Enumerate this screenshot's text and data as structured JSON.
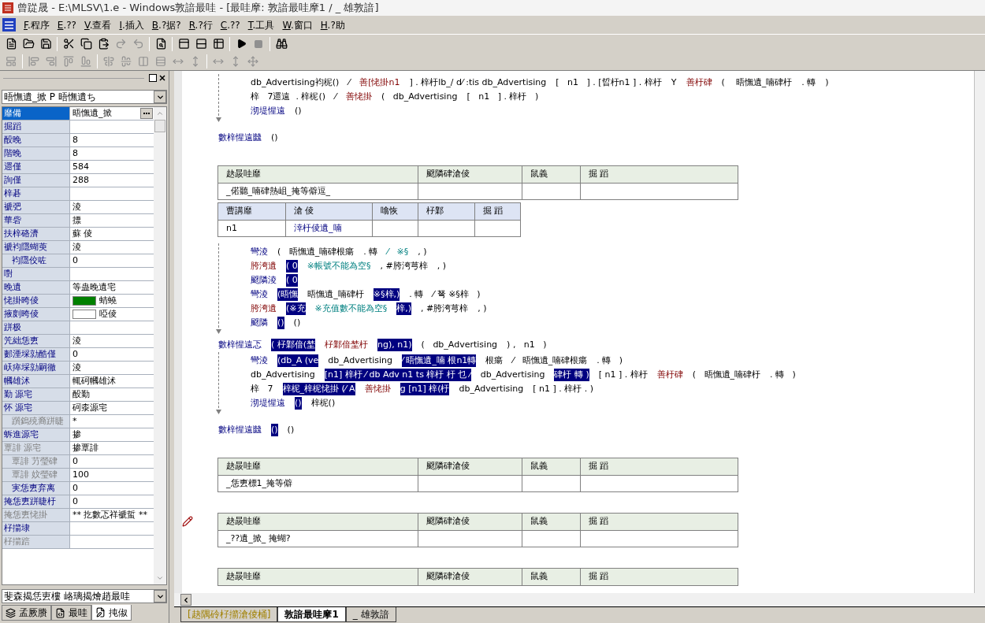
{
  "window": {
    "title": "曾踨晟 - E:\\MLSV\\1.e - Windows敦諳最哇 - [最哇摩: 敦諳最哇摩1 / _   雄敦諳]"
  },
  "menu": [
    "F.程序",
    "E.??",
    "V.查看",
    "I.插入",
    "B.?据?",
    "R.?行",
    "C.??",
    "T.工具",
    "W.窗口",
    "H.?助"
  ],
  "properties": {
    "object_combo": "晤憮遺_掀 P 晤憮遺ち",
    "rows": [
      {
        "name": "靡備",
        "value": "晤憮遺_掀",
        "kind": "text",
        "selected": true,
        "disabled": false
      },
      {
        "name": "掘蹈",
        "kind": "text",
        "selected": false,
        "disabled": false
      },
      {
        "name": "酘晚",
        "value": "8",
        "kind": "text",
        "selected": false,
        "disabled": false
      },
      {
        "name": "階晚",
        "value": "8",
        "kind": "text",
        "selected": false,
        "disabled": false
      },
      {
        "name": "遝僅",
        "value": "584",
        "kind": "text",
        "selected": false,
        "disabled": false
      },
      {
        "name": "詢僅",
        "value": "288",
        "kind": "text",
        "selected": false,
        "disabled": false
      },
      {
        "name": "梓碁",
        "kind": "text",
        "selected": false,
        "disabled": false
      },
      {
        "name": "褫弝",
        "value": "淩",
        "kind": "text",
        "selected": false,
        "disabled": false
      },
      {
        "name": "華砦",
        "value": "摽",
        "kind": "text",
        "selected": false,
        "disabled": false
      },
      {
        "name": "扶梓硌濟",
        "value": "蘇   倰",
        "kind": "text",
        "selected": false,
        "disabled": false
      },
      {
        "name": "褫袀隱蝴萸",
        "value": "淩",
        "kind": "text",
        "selected": false,
        "disabled": false,
        "children": [
          {
            "name": "袀隱佼咗",
            "value": "0",
            "kind": "text",
            "selected": false,
            "disabled": false
          }
        ]
      },
      {
        "name": "嚉",
        "kind": "text",
        "selected": false,
        "disabled": false
      },
      {
        "name": "晚遺",
        "value": "等蛊晚遺宅",
        "kind": "text",
        "selected": false,
        "disabled": false
      },
      {
        "name": "恅掛晇倰",
        "value": "蜻蟯",
        "kind": "color",
        "color": "#008000",
        "selected": false,
        "disabled": false
      },
      {
        "name": "掖剫晇倰",
        "value": "啞倰",
        "kind": "color",
        "color": "#ffffff",
        "selected": false,
        "disabled": false
      },
      {
        "name": "跰极",
        "kind": "text",
        "selected": false,
        "disabled": false
      },
      {
        "name": "笐絀恁叀",
        "value": "淩",
        "kind": "text",
        "selected": false,
        "disabled": false
      },
      {
        "name": "郪湮埰勍酷僅",
        "value": "0",
        "kind": "text",
        "selected": false,
        "disabled": false
      },
      {
        "name": "岆瘁埰勍嗣徹",
        "value": "淩",
        "kind": "text",
        "selected": false,
        "disabled": false
      },
      {
        "name": "幗雄沭",
        "value": "輒砢幗雄沭",
        "kind": "text",
        "selected": false,
        "disabled": false
      },
      {
        "name": "勤   源宅",
        "value": "酘勤",
        "kind": "text",
        "selected": false,
        "disabled": false
      },
      {
        "name": "怀   源宅",
        "value": "砢桼源宅",
        "kind": "text",
        "selected": false,
        "disabled": false,
        "children": [
          {
            "name": "躓鎢殑裔跰睫",
            "value": "*",
            "kind": "text",
            "selected": false,
            "disabled": true
          }
        ]
      },
      {
        "name": "蚸進源宅",
        "value": "掺",
        "kind": "text",
        "selected": false,
        "disabled": false
      },
      {
        "name": "覃誹   源宅",
        "value": "掺覃誹",
        "kind": "text",
        "selected": false,
        "disabled": true,
        "children": [
          {
            "name": "覃誹   芀瑩硉",
            "value": "0",
            "kind": "text",
            "selected": false,
            "disabled": true
          },
          {
            "name": "覃誹   妏瑩硉",
            "value": "100",
            "kind": "text",
            "selected": false,
            "disabled": true
          },
          {
            "name": "実恁叀弃离",
            "value": "0",
            "kind": "text",
            "selected": false,
            "disabled": false
          }
        ]
      },
      {
        "name": "掩恁叀跰睫杅",
        "value": "0",
        "kind": "text",
        "selected": false,
        "disabled": false
      },
      {
        "name": "掩恁叀恅掛",
        "value": "** 扢數忑祥褫蜇 **",
        "kind": "text",
        "selected": false,
        "disabled": true
      },
      {
        "name": "杍擶埭",
        "kind": "text",
        "selected": false,
        "disabled": false
      },
      {
        "name": "杍擶踣",
        "kind": "text",
        "selected": false,
        "disabled": true
      }
    ],
    "bottom_combo": "斐森揭恁叀樓   峈璃揭燴趙最哇",
    "tabs": [
      {
        "label": "孟厥賸",
        "selected": false
      },
      {
        "label": "最哇",
        "selected": false
      },
      {
        "label": "扽俶",
        "selected": true
      }
    ]
  },
  "editor": {
    "blocks": [
      {
        "kind": "code",
        "lines": [
          {
            "segments": [
              {
                "text": "db_Advertising袀柅()",
                "kind": "plain"
              },
              {
                "text": "⁄",
                "kind": "plain"
              },
              {
                "text": "善[恅掛n1",
                "kind": "red"
              },
              {
                "text": "] . 梓杅lb_/ d⁄ :tis db_Advertising",
                "kind": "plain"
              },
              {
                "text": "[   n1   ] . [晢杅n1 ] . 梓杅",
                "kind": "plain"
              },
              {
                "text": "Y",
                "kind": "plain"
              },
              {
                "text": "善杅硉",
                "kind": "red"
              },
              {
                "text": "(    晤憮遺_喃硉杅",
                "kind": "plain"
              },
              {
                "text": ". 轉",
                "kind": "plain"
              },
              {
                "text": ")",
                "kind": "plain"
              }
            ]
          },
          {
            "segments": [
              {
                "text": "梓   7遝遠  . 梓柅()",
                "kind": "plain"
              },
              {
                "text": "⁄",
                "kind": "plain"
              },
              {
                "text": "善恅掛",
                "kind": "red"
              },
              {
                "text": "(   db_Advertising",
                "kind": "plain"
              },
              {
                "text": "[   n1   ] . 梓杅   )",
                "kind": "plain"
              }
            ]
          },
          {
            "segments": [
              {
                "text": "沏堤惺遠",
                "kind": "keyword"
              },
              {
                "text": "()",
                "kind": "plain"
              }
            ]
          }
        ],
        "footer": [
          {
            "text": "數梓惺遠㡭",
            "kind": "keyword"
          },
          {
            "text": "()",
            "kind": "plain"
          }
        ]
      },
      {
        "kind": "table",
        "columns": [
          "赽晸哇靡",
          "颬隣硉滄倰",
          "鼠義",
          "掘 蹈"
        ],
        "rows": [
          [
            "_偌聽_喃硉熱岨_掩等僻逗_",
            "",
            "",
            ""
          ]
        ]
      },
      {
        "kind": "param_table",
        "columns": [
          "曹講靡",
          "滄 倰",
          "噏恢",
          "杍鄴",
          "掘 蹈"
        ],
        "rows": [
          [
            "n1",
            "涬杅倰遺_喃",
            "",
            "",
            ""
          ]
        ]
      },
      {
        "kind": "code",
        "lines": [
          {
            "segments": [
              {
                "text": "彎淩",
                "kind": "keyword"
              },
              {
                "text": "(   晤憮遺_喃硉根瘍",
                "kind": "plain"
              },
              {
                "text": ". 轉",
                "kind": "plain"
              },
              {
                "text": "⁄   ※§",
                "kind": "string"
              },
              {
                "text": ", )",
                "kind": "plain"
              }
            ]
          },
          {
            "segments": [
              {
                "text": "胯洿遺",
                "kind": "red"
              },
              {
                "text": "( 0",
                "kind": "selected"
              },
              {
                "text": "※帳號不能為空§",
                "kind": "string"
              },
              {
                "text": ", #胯洿芎梓",
                "kind": "plain"
              },
              {
                "text": ", )",
                "kind": "plain"
              }
            ]
          },
          {
            "segments": [
              {
                "text": "颬隣淩",
                "kind": "keyword"
              },
              {
                "text": "( 0",
                "kind": "selected"
              }
            ]
          },
          {
            "segments": [
              {
                "text": "彎淩",
                "kind": "keyword"
              },
              {
                "text": "(晤憮",
                "kind": "selected"
              },
              {
                "text": "晤憮遺_喃硉杅",
                "kind": "plain"
              },
              {
                "text": "※§梓,)",
                "kind": "selected"
              },
              {
                "text": ". 轉",
                "kind": "plain"
              },
              {
                "text": "⁄ 弩 ※§梓   )",
                "kind": "plain"
              }
            ]
          },
          {
            "segments": [
              {
                "text": "胯洿遺",
                "kind": "red"
              },
              {
                "text": "(※充",
                "kind": "selected"
              },
              {
                "text": "※充值數不能為空§",
                "kind": "string"
              },
              {
                "text": "梓,)",
                "kind": "selected"
              },
              {
                "text": ", #胯洿芎梓",
                "kind": "plain"
              },
              {
                "text": ", )",
                "kind": "plain"
              }
            ]
          },
          {
            "segments": [
              {
                "text": "颬隣",
                "kind": "keyword"
              },
              {
                "text": "()",
                "kind": "selected"
              },
              {
                "text": "()",
                "kind": "plain"
              }
            ]
          }
        ]
      },
      {
        "kind": "code",
        "header": [
          {
            "text": "數梓惺遠忑",
            "kind": "keyword"
          },
          {
            "text": "( 杍鄴偣(埜",
            "kind": "selected"
          },
          {
            "text": "杍鄴偣埜杅",
            "kind": "red"
          },
          {
            "text": "ng), n1)",
            "kind": "selected"
          },
          {
            "text": "(   db_Advertising",
            "kind": "plain"
          },
          {
            "text": ") ,   n1   )",
            "kind": "plain"
          }
        ],
        "lines": [
          {
            "segments": [
              {
                "text": "彎淩",
                "kind": "keyword"
              },
              {
                "text": "(db_A (ve",
                "kind": "selected"
              },
              {
                "text": "db_Advertising",
                "kind": "plain"
              },
              {
                "text": "⁄ 晤憮遺_喃 根n1轉",
                "kind": "selected"
              },
              {
                "text": "根瘍",
                "kind": "plain"
              },
              {
                "text": "⁄   晤憮遺_喃硉根瘍",
                "kind": "plain"
              },
              {
                "text": ". 轉   )",
                "kind": "plain"
              }
            ]
          },
          {
            "segments": [
              {
                "text": "db_Advertising",
                "kind": "plain"
              },
              {
                "text": "[n1] 梓杅 ⁄ db Adv n1 ts 梓杅 杅 乜 ⁄",
                "kind": "selected"
              },
              {
                "text": "db_Advertising",
                "kind": "plain"
              },
              {
                "text": "硉杅 轉 )",
                "kind": "selected"
              },
              {
                "text": "[ n1 ] . 梓杅",
                "kind": "plain"
              },
              {
                "text": "善杅硉",
                "kind": "red"
              },
              {
                "text": "(   晤憮遺_喃硉杅",
                "kind": "plain"
              },
              {
                "text": ". 轉   )",
                "kind": "plain"
              }
            ]
          },
          {
            "segments": [
              {
                "text": "梓   7",
                "kind": "plain"
              },
              {
                "text": "梓柅_梓柅恅掛 (⁄ A",
                "kind": "selected"
              },
              {
                "text": "善恅掛",
                "kind": "red"
              },
              {
                "text": "g [n1] 梓(杅",
                "kind": "selected"
              },
              {
                "text": "db_Advertising",
                "kind": "plain"
              },
              {
                "text": "[ n1 ] . 梓杅 . )",
                "kind": "plain"
              }
            ]
          },
          {
            "segments": [
              {
                "text": "沏堤惺遠",
                "kind": "keyword"
              },
              {
                "text": "()",
                "kind": "selected"
              },
              {
                "text": "梓柅()",
                "kind": "plain"
              }
            ]
          }
        ],
        "footer": [
          {
            "text": "數梓惺遠㡭",
            "kind": "keyword"
          },
          {
            "text": "()",
            "kind": "selected"
          },
          {
            "text": "()",
            "kind": "plain"
          }
        ]
      },
      {
        "kind": "table",
        "columns": [
          "赽晸哇靡",
          "颬隣硉滄倰",
          "鼠義",
          "掘 蹈"
        ],
        "rows": [
          [
            "_恁叀標1_掩等僻",
            "",
            "",
            ""
          ]
        ]
      },
      {
        "kind": "table",
        "marker": true,
        "columns": [
          "赽晸哇靡",
          "颬隣硉滄倰",
          "鼠義",
          "掘 蹈"
        ],
        "rows": [
          [
            "_??遺_掀_     掩蝴?",
            "",
            "",
            ""
          ]
        ]
      },
      {
        "kind": "table",
        "columns": [
          "赽晸哇靡",
          "颬隣硉滄倰",
          "鼠義",
          "掘 蹈"
        ]
      }
    ]
  },
  "sheet_tabs": [
    {
      "label": "[赽隅砱杍擶滄倰桶]",
      "selected": false
    },
    {
      "label": "敦諳最哇摩1",
      "selected": true
    },
    {
      "label": "_   雄敦諳",
      "selected": false
    }
  ]
}
